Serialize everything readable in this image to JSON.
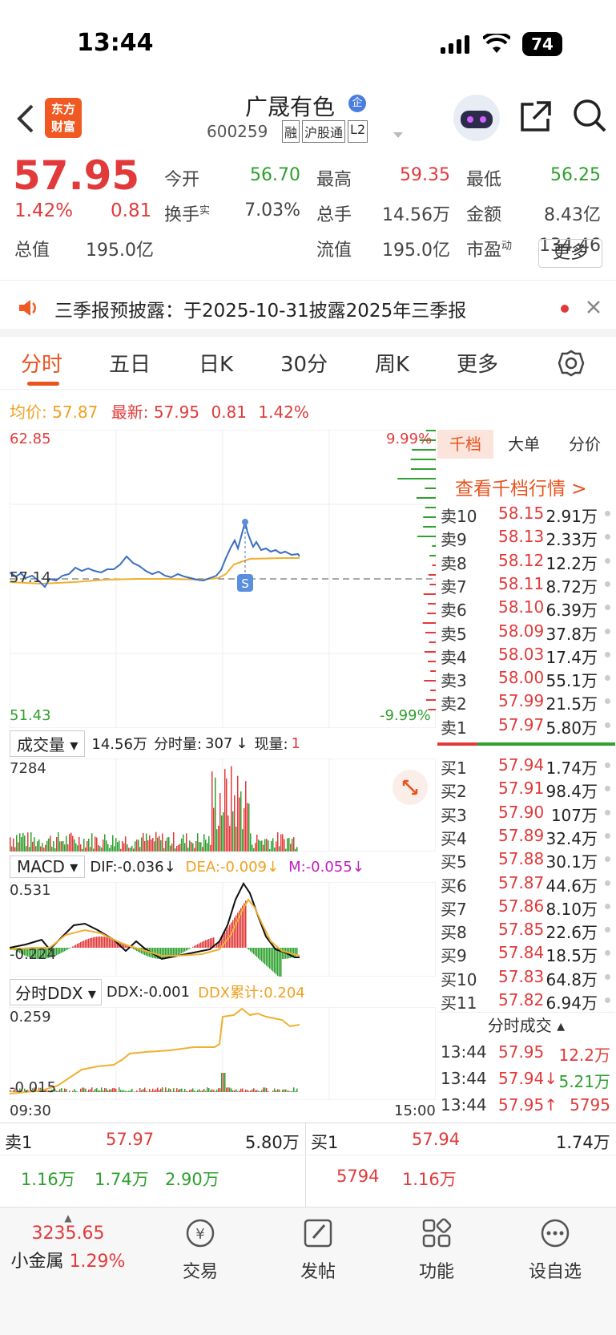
{
  "status_bar": {
    "time": "13:44",
    "battery": "74"
  },
  "header": {
    "logo_l1": "东方",
    "logo_l2": "财富",
    "name": "广晟有色",
    "badge": "企",
    "code": "600259",
    "tags": [
      "融",
      "沪股通",
      "L2"
    ]
  },
  "quote": {
    "price": "57.95",
    "pct": "1.42%",
    "chg": "0.81",
    "fields": [
      {
        "label": "今开",
        "value": "56.70",
        "color": "green"
      },
      {
        "label": "最高",
        "value": "59.35",
        "color": "red"
      },
      {
        "label": "最低",
        "value": "56.25",
        "color": "green"
      },
      {
        "label": "换手",
        "sup": "实",
        "value": "7.03%",
        "color": "gray"
      },
      {
        "label": "总手",
        "value": "14.56万",
        "color": "gray"
      },
      {
        "label": "金额",
        "value": "8.43亿",
        "color": "gray"
      },
      {
        "label": "总值",
        "value": "195.0亿",
        "color": "gray"
      },
      {
        "label": "流值",
        "value": "195.0亿",
        "color": "gray"
      },
      {
        "label": "市盈",
        "sup": "动",
        "value": "134.46",
        "color": "gray"
      }
    ],
    "more_btn": "更多"
  },
  "notice": {
    "text": "三季报预披露：于2025-10-31披露2025年三季报"
  },
  "tabs": [
    "分时",
    "五日",
    "日K",
    "30分",
    "周K",
    "更多"
  ],
  "avg_line": {
    "avg_label": "均价:",
    "avg": "57.87",
    "latest_label": "最新:",
    "latest": "57.95",
    "chg": "0.81",
    "pct": "1.42%"
  },
  "price_chart": {
    "top": "62.85",
    "mid": "57.14",
    "bottom": "51.43",
    "top_pct": "9.99%",
    "bottom_pct": "-9.99%",
    "marker": "S"
  },
  "volume": {
    "selector": "成交量",
    "total": "14.56万",
    "fs_label": "分时量:",
    "fs": "307",
    "now_label": "现量:",
    "now": "1",
    "axis_top": "7284"
  },
  "macd": {
    "selector": "MACD",
    "dif": "DIF:-0.036",
    "dea": "DEA:-0.009",
    "m": "M:-0.055",
    "top": "0.531",
    "bottom": "-0.224"
  },
  "ddx": {
    "selector": "分时DDX",
    "ddx": "DDX:-0.001",
    "ddx_acc": "DDX累计:0.204",
    "top": "0.259",
    "bottom": "-0.015",
    "t_start": "09:30",
    "t_end": "15:00"
  },
  "orderbook": {
    "tabs": [
      "千档",
      "大单",
      "分价"
    ],
    "link": "查看千档行情 >",
    "asks": [
      {
        "label": "卖10",
        "price": "58.15",
        "vol": "2.91万"
      },
      {
        "label": "卖9",
        "price": "58.13",
        "vol": "2.33万"
      },
      {
        "label": "卖8",
        "price": "58.12",
        "vol": "12.2万"
      },
      {
        "label": "卖7",
        "price": "58.11",
        "vol": "8.72万"
      },
      {
        "label": "卖6",
        "price": "58.10",
        "vol": "6.39万"
      },
      {
        "label": "卖5",
        "price": "58.09",
        "vol": "37.8万"
      },
      {
        "label": "卖4",
        "price": "58.03",
        "vol": "17.4万"
      },
      {
        "label": "卖3",
        "price": "58.00",
        "vol": "55.1万"
      },
      {
        "label": "卖2",
        "price": "57.99",
        "vol": "21.5万"
      },
      {
        "label": "卖1",
        "price": "57.97",
        "vol": "5.80万"
      }
    ],
    "bids": [
      {
        "label": "买1",
        "price": "57.94",
        "vol": "1.74万"
      },
      {
        "label": "买2",
        "price": "57.91",
        "vol": "98.4万"
      },
      {
        "label": "买3",
        "price": "57.90",
        "vol": "107万"
      },
      {
        "label": "买4",
        "price": "57.89",
        "vol": "32.4万"
      },
      {
        "label": "买5",
        "price": "57.88",
        "vol": "30.1万"
      },
      {
        "label": "买6",
        "price": "57.87",
        "vol": "44.6万"
      },
      {
        "label": "买7",
        "price": "57.86",
        "vol": "8.10万"
      },
      {
        "label": "买8",
        "price": "57.85",
        "vol": "22.6万"
      },
      {
        "label": "买9",
        "price": "57.84",
        "vol": "18.5万"
      },
      {
        "label": "买10",
        "price": "57.83",
        "vol": "64.8万"
      },
      {
        "label": "买11",
        "price": "57.82",
        "vol": "6.94万"
      }
    ],
    "trades_title": "分时成交",
    "trades": [
      {
        "time": "13:44",
        "price": "57.95",
        "vol": "12.2万"
      },
      {
        "time": "13:44",
        "price": "57.94↓",
        "vol": "5.21万"
      },
      {
        "time": "13:44",
        "price": "57.95↑",
        "vol": "5795"
      }
    ]
  },
  "bottom_quote": {
    "sell_label": "卖1",
    "sell_price": "57.97",
    "sell_vol": "5.80万",
    "sell_subs": [
      "1.16万",
      "1.74万",
      "2.90万"
    ],
    "buy_label": "买1",
    "buy_price": "57.94",
    "buy_vol": "1.74万",
    "buy_subs": [
      "5794",
      "1.16万"
    ]
  },
  "toolbar": {
    "index_value": "3235.65",
    "index_name": "小金属",
    "index_pct": "1.29%",
    "items": [
      "交易",
      "发帖",
      "功能",
      "设自选"
    ]
  }
}
